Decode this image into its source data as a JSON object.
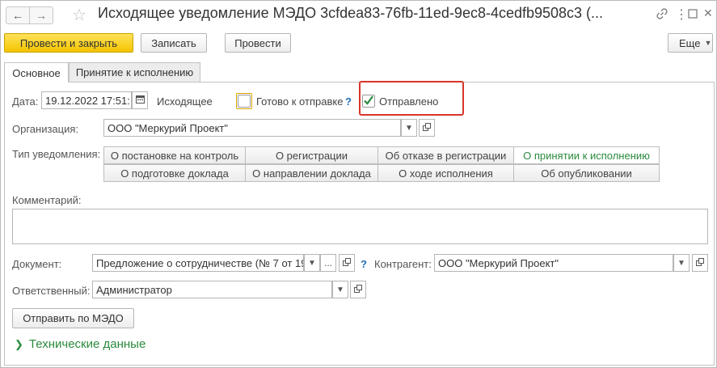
{
  "window": {
    "title": "Исходящее уведомление МЭДО 3cfdea83-76fb-11ed-9ec8-4cedfb9508c3 (...",
    "back_icon": "arrow-left-icon",
    "forward_icon": "arrow-right-icon",
    "favorite_icon": "star-icon",
    "link_icon": "link-icon",
    "menu_icon": "more-vertical-icon",
    "maximize_icon": "maximize-icon",
    "close_icon": "close-icon"
  },
  "toolbar": {
    "post_and_close": "Провести и закрыть",
    "save": "Записать",
    "post": "Провести",
    "more": "Еще"
  },
  "tabs": [
    {
      "label": "Основное",
      "active": true
    },
    {
      "label": "Принятие к исполнению",
      "active": false
    }
  ],
  "form": {
    "date_label": "Дата:",
    "date_value": "19.12.2022 17:51:",
    "direction": "Исходящее",
    "ready_label": "Готово к отправке",
    "ready_checked": false,
    "help": "?",
    "sent_label": "Отправлено",
    "sent_checked": true,
    "org_label": "Организация:",
    "org_value": "ООО \"Меркурий Проект\"",
    "type_label": "Тип уведомления:",
    "types_row1": [
      "О постановке на контроль",
      "О регистрации",
      "Об отказе в регистрации",
      "О принятии к исполнению"
    ],
    "types_row2": [
      "О подготовке доклада",
      "О направлении доклада",
      "О ходе исполнения",
      "Об опубликовании"
    ],
    "selected_type": "О принятии к исполнению",
    "comment_label": "Комментарий:",
    "comment_value": "",
    "doc_label": "Документ:",
    "doc_value": "Предложение о сотрудничестве (№ 7 от 19",
    "doc_more": "...",
    "help2": "?",
    "contractor_label": "Контрагент:",
    "contractor_value": "ООО \"Меркурий Проект\"",
    "resp_label": "Ответственный:",
    "resp_value": "Администратор",
    "send_button": "Отправить по МЭДО",
    "tech_section": "Технические данные"
  },
  "colors": {
    "primary_button": "#f4c400",
    "selected_type_text": "#2a8a3c",
    "highlight_border": "#d9342b",
    "section_link": "#2a8a3c"
  }
}
